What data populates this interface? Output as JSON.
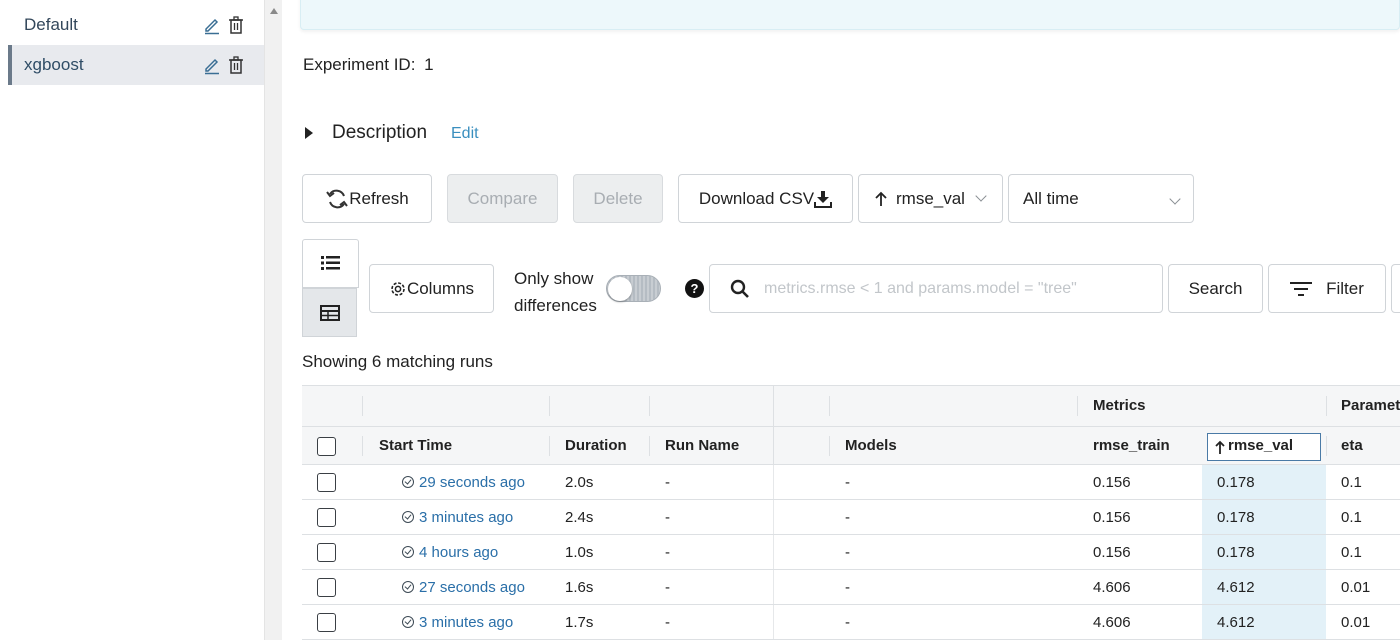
{
  "sidebar": {
    "experiments": [
      {
        "label": "Default",
        "active": false
      },
      {
        "label": "xgboost",
        "active": true
      }
    ]
  },
  "experiment": {
    "id_label": "Experiment ID:",
    "id_value": "1",
    "description_label": "Description",
    "edit_label": "Edit"
  },
  "toolbar": {
    "refresh": "Refresh",
    "compare": "Compare",
    "delete": "Delete",
    "download_csv": "Download CSV",
    "sort_value": "rmse_val",
    "time_value": "All time",
    "columns": "Columns",
    "only_show_line1": "Only show",
    "only_show_line2": "differences",
    "help": "?",
    "search_placeholder": "metrics.rmse < 1 and params.model = \"tree\"",
    "search": "Search",
    "filter": "Filter"
  },
  "runs_count": "Showing 6 matching runs",
  "table": {
    "groups": {
      "metrics": "Metrics",
      "parameters": "Paramet"
    },
    "columns": {
      "start_time": "Start Time",
      "duration": "Duration",
      "run_name": "Run Name",
      "models": "Models",
      "rmse_train": "rmse_train",
      "rmse_val": "rmse_val",
      "eta": "eta"
    },
    "rows": [
      {
        "start_time": "29 seconds ago",
        "duration": "2.0s",
        "run_name": "-",
        "models": "-",
        "rmse_train": "0.156",
        "rmse_val": "0.178",
        "eta": "0.1"
      },
      {
        "start_time": "3 minutes ago",
        "duration": "2.4s",
        "run_name": "-",
        "models": "-",
        "rmse_train": "0.156",
        "rmse_val": "0.178",
        "eta": "0.1"
      },
      {
        "start_time": "4 hours ago",
        "duration": "1.0s",
        "run_name": "-",
        "models": "-",
        "rmse_train": "0.156",
        "rmse_val": "0.178",
        "eta": "0.1"
      },
      {
        "start_time": "27 seconds ago",
        "duration": "1.6s",
        "run_name": "-",
        "models": "-",
        "rmse_train": "4.606",
        "rmse_val": "4.612",
        "eta": "0.01"
      },
      {
        "start_time": "3 minutes ago",
        "duration": "1.7s",
        "run_name": "-",
        "models": "-",
        "rmse_train": "4.606",
        "rmse_val": "4.612",
        "eta": "0.01"
      }
    ]
  }
}
